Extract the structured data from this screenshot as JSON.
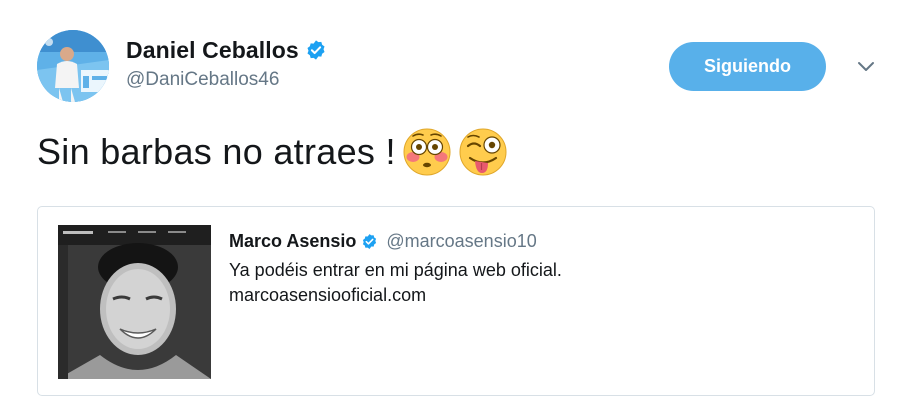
{
  "user": {
    "display_name": "Daniel Ceballos",
    "handle": "@DaniCeballos46",
    "verified": true,
    "avatar_icon": "profile-photo"
  },
  "actions": {
    "follow_label": "Siguiendo",
    "more_icon": "chevron-down-icon"
  },
  "tweet": {
    "text": "Sin barbas no atraes !",
    "emojis": [
      "flushed-face-emoji",
      "winking-face-with-tongue-emoji"
    ]
  },
  "quoted_tweet": {
    "display_name": "Marco Asensio",
    "handle": "@marcoasensio10",
    "verified": true,
    "text_line_1": "Ya podéis entrar en mi página web oficial.",
    "text_line_2": "marcoasensiooficial.com",
    "image_icon": "quoted-photo"
  },
  "colors": {
    "follow_button_bg": "#58b0ea",
    "verified_blue": "#1da1f2",
    "secondary_text": "#657786",
    "card_border": "#d8e0e6"
  }
}
